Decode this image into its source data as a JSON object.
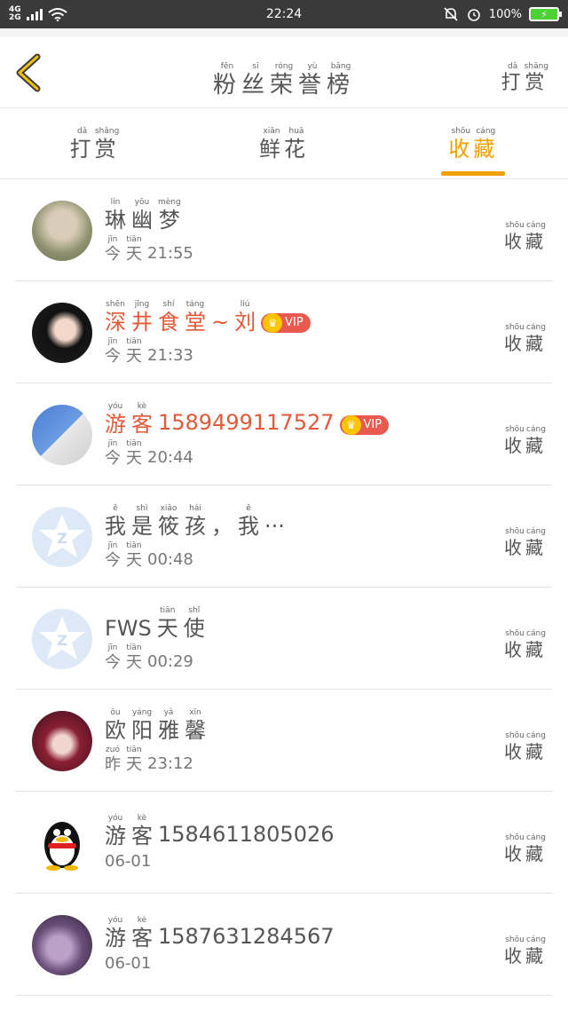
{
  "status_bar": {
    "network_top": "4G",
    "network_bottom": "2G",
    "time": "22:24",
    "battery": "100%",
    "icons": [
      "signal-icon",
      "wifi-icon",
      "bell-off-icon",
      "alarm-icon",
      "battery-icon"
    ]
  },
  "header": {
    "title_chars": [
      {
        "c": "粉",
        "p": "fěn"
      },
      {
        "c": "丝",
        "p": "sī"
      },
      {
        "c": "荣",
        "p": "róng"
      },
      {
        "c": "誉",
        "p": "yù"
      },
      {
        "c": "榜",
        "p": "bǎng"
      }
    ],
    "right_chars": [
      {
        "c": "打",
        "p": "dǎ"
      },
      {
        "c": "赏",
        "p": "shǎng"
      }
    ]
  },
  "tabs": [
    {
      "chars": [
        {
          "c": "打",
          "p": "dǎ"
        },
        {
          "c": "赏",
          "p": "shǎng"
        }
      ],
      "active": false
    },
    {
      "chars": [
        {
          "c": "鲜",
          "p": "xiān"
        },
        {
          "c": "花",
          "p": "huā"
        }
      ],
      "active": false
    },
    {
      "chars": [
        {
          "c": "收",
          "p": "shōu"
        },
        {
          "c": "藏",
          "p": "cáng"
        }
      ],
      "active": true
    }
  ],
  "fav_chars": [
    {
      "c": "收",
      "p": "shōu"
    },
    {
      "c": "藏",
      "p": "cáng"
    }
  ],
  "today_chars": [
    {
      "c": "今",
      "p": "jīn"
    },
    {
      "c": "天",
      "p": "tiān"
    }
  ],
  "yesterday_chars": [
    {
      "c": "昨",
      "p": "zuó"
    },
    {
      "c": "天",
      "p": "tiān"
    }
  ],
  "vip_label": "VIP",
  "users": [
    {
      "name_prefix": [
        {
          "c": "琳",
          "p": "lín"
        },
        {
          "c": "幽",
          "p": "yōu"
        },
        {
          "c": "梦",
          "p": "mèng"
        }
      ],
      "name_suffix": "",
      "time": "21:55",
      "day": "today",
      "vip": false,
      "red": false,
      "avatar": "av-green"
    },
    {
      "name_prefix": [
        {
          "c": "深",
          "p": "shēn"
        },
        {
          "c": "井",
          "p": "jǐng"
        },
        {
          "c": "食",
          "p": "shí"
        },
        {
          "c": "堂",
          "p": "táng"
        },
        {
          "c": "~",
          "p": ""
        },
        {
          "c": "刘",
          "p": "liú"
        }
      ],
      "name_suffix": "",
      "time": "21:33",
      "day": "today",
      "vip": true,
      "red": true,
      "avatar": "av-dark"
    },
    {
      "name_prefix": [
        {
          "c": "游",
          "p": "yóu"
        },
        {
          "c": "客",
          "p": "kè"
        }
      ],
      "name_suffix": "15894991175​27",
      "time": "20:44",
      "day": "today",
      "vip": true,
      "red": true,
      "avatar": "av-blue"
    },
    {
      "name_prefix": [
        {
          "c": "我",
          "p": "ě"
        },
        {
          "c": "是",
          "p": "shì"
        },
        {
          "c": "筱",
          "p": "xiǎo"
        },
        {
          "c": "孩",
          "p": "hái"
        },
        {
          "c": "，",
          "p": ""
        },
        {
          "c": "我",
          "p": "ě"
        },
        {
          "c": "···",
          "p": ""
        }
      ],
      "name_suffix": "",
      "time": "00:48",
      "day": "today",
      "vip": false,
      "red": false,
      "avatar": "av-default"
    },
    {
      "name_prefix": [
        {
          "c": "FWS",
          "p": ""
        },
        {
          "c": "天",
          "p": "tiān"
        },
        {
          "c": "使",
          "p": "shǐ"
        }
      ],
      "name_suffix": "",
      "time": "00:29",
      "day": "today",
      "vip": false,
      "red": false,
      "avatar": "av-default"
    },
    {
      "name_prefix": [
        {
          "c": "欧",
          "p": "ōu"
        },
        {
          "c": "阳",
          "p": "yáng"
        },
        {
          "c": "雅",
          "p": "yǎ"
        },
        {
          "c": "馨",
          "p": "xīn"
        }
      ],
      "name_suffix": "",
      "time": "23:12",
      "day": "yesterday",
      "vip": false,
      "red": false,
      "avatar": "av-red"
    },
    {
      "name_prefix": [
        {
          "c": "游",
          "p": "yóu"
        },
        {
          "c": "客",
          "p": "kè"
        }
      ],
      "name_suffix": "15846118050​26",
      "time": "06-01",
      "day": "",
      "vip": false,
      "red": false,
      "avatar": "av-qq"
    },
    {
      "name_prefix": [
        {
          "c": "游",
          "p": "yóu"
        },
        {
          "c": "客",
          "p": "kè"
        }
      ],
      "name_suffix": "15876312845​67",
      "time": "06-01",
      "day": "",
      "vip": false,
      "red": false,
      "avatar": "av-purple"
    }
  ]
}
